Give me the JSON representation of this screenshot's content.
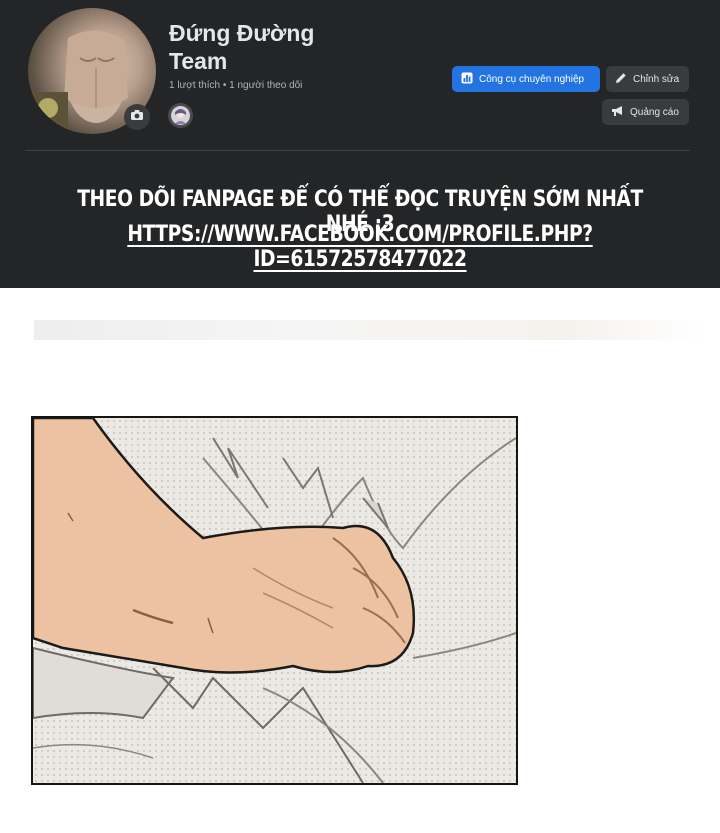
{
  "profile": {
    "name": "Đứng Đường Team",
    "stats": "1 lượt thích • 1 người theo dõi"
  },
  "actions": {
    "professional_tools_label": "Công cụ chuyên nghiệp",
    "edit_label": "Chỉnh sửa",
    "ads_label": "Quảng cáo"
  },
  "notice": {
    "line1": "THEO DÕI FANPAGE ĐỂ CÓ THỂ ĐỌC TRUYỆN SỚM NHẤT NHÉ :3",
    "link": "HTTPS://WWW.FACEBOOK.COM/PROFILE.PHP?ID=61572578477022"
  },
  "icons": {
    "camera": "camera-icon",
    "dashboard": "bar-chart-icon",
    "edit": "pencil-icon",
    "ads": "megaphone-icon"
  },
  "colors": {
    "banner_bg": "#242526",
    "primary_button": "#2374e1",
    "secondary_button": "#3a3b3c",
    "text_primary": "#e4e6eb",
    "text_secondary": "#b0b3b8"
  }
}
